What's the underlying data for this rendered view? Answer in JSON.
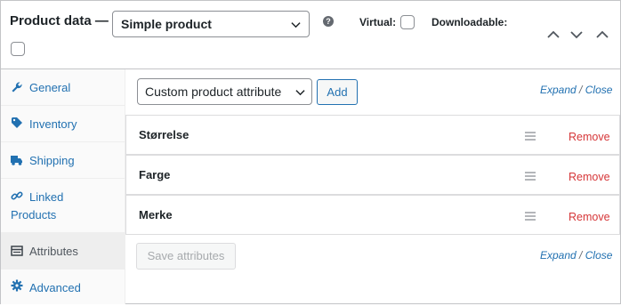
{
  "header": {
    "title": "Product data —",
    "product_type_selected": "Simple product",
    "virtual_label": "Virtual:",
    "virtual_checked": false,
    "downloadable_label": "Downloadable:",
    "downloadable_checked": false,
    "help_glyph": "?"
  },
  "tabs": [
    {
      "label": "General",
      "icon": "wrench-icon"
    },
    {
      "label": "Inventory",
      "icon": "tag-icon"
    },
    {
      "label": "Shipping",
      "icon": "truck-icon"
    },
    {
      "label_line1": "Linked",
      "label_line2": "Products",
      "icon": "link-icon"
    },
    {
      "label": "Attributes",
      "icon": "list-icon",
      "active": true
    },
    {
      "label": "Advanced",
      "icon": "gear-icon"
    }
  ],
  "toolbar": {
    "attribute_select_value": "Custom product attribute",
    "add_label": "Add",
    "expand_label": "Expand",
    "separator": "/",
    "close_label": "Close"
  },
  "attributes": [
    {
      "name": "Størrelse",
      "remove_label": "Remove"
    },
    {
      "name": "Farge",
      "remove_label": "Remove"
    },
    {
      "name": "Merke",
      "remove_label": "Remove"
    }
  ],
  "footer": {
    "save_label": "Save attributes",
    "expand_label": "Expand",
    "separator": "/",
    "close_label": "Close"
  },
  "colors": {
    "link": "#2271b1",
    "remove": "#d63638",
    "border": "#c3c4c7",
    "tab_bg": "#fafafa",
    "tab_active_bg": "#eeeeee"
  }
}
